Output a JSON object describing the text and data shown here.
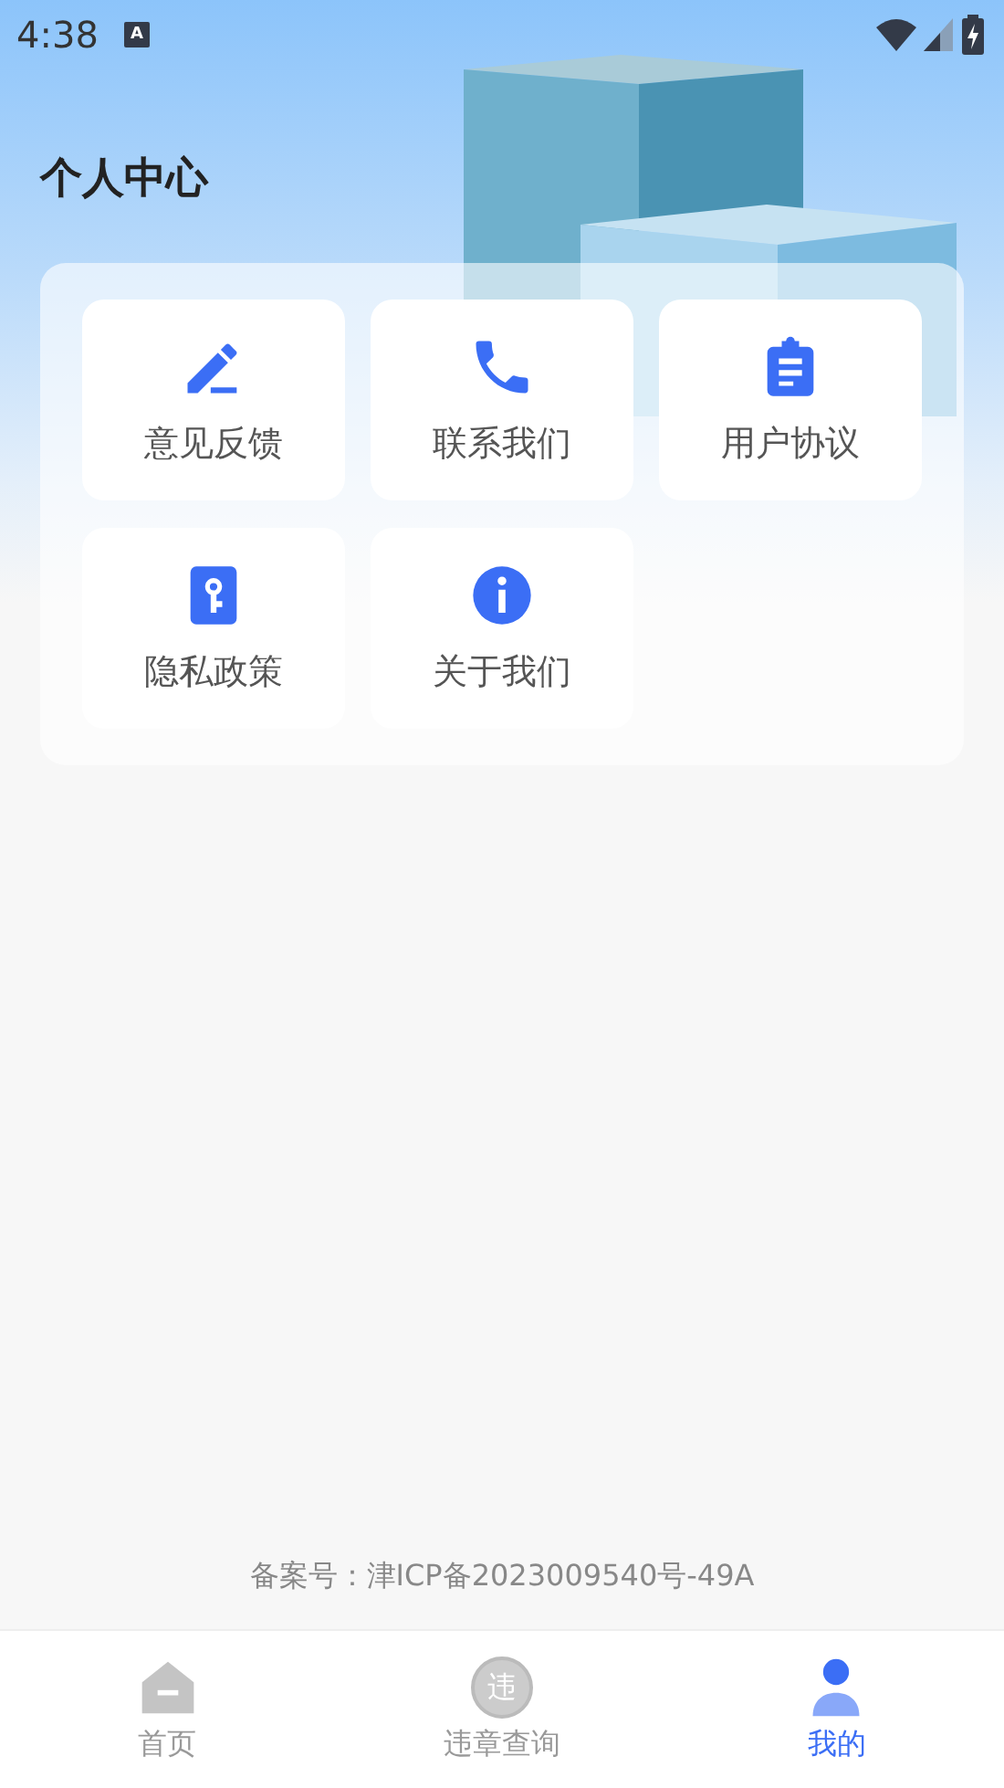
{
  "status_bar": {
    "time": "4:38",
    "notification_icon": "A"
  },
  "title": "个人中心",
  "menu_items": [
    {
      "label": "意见反馈",
      "kind": "pencil"
    },
    {
      "label": "联系我们",
      "kind": "phone"
    },
    {
      "label": "用户协议",
      "kind": "clipboard"
    },
    {
      "label": "隐私政策",
      "kind": "key"
    },
    {
      "label": "关于我们",
      "kind": "info"
    }
  ],
  "footer": "备案号：津ICP备2023009540号-49A",
  "bottom_nav": [
    {
      "label": "首页",
      "kind": "home",
      "selected": false
    },
    {
      "label": "违章查询",
      "kind": "char",
      "icon_char": "违",
      "selected": false
    },
    {
      "label": "我的",
      "kind": "person",
      "selected": true
    }
  ]
}
